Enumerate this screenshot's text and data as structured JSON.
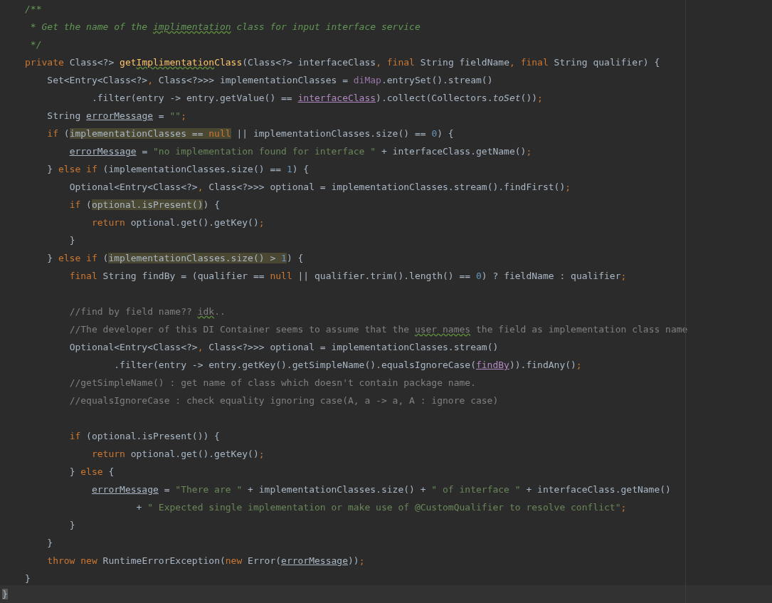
{
  "editor": {
    "lines": [
      {
        "tokens": [
          {
            "text": "/**",
            "kind": "doc"
          }
        ]
      },
      {
        "tokens": [
          {
            "text": " * Get the name of the ",
            "kind": "doc"
          },
          {
            "text": "implimentation",
            "kind": "doc",
            "typo": true
          },
          {
            "text": " class for input interface service",
            "kind": "doc"
          }
        ]
      },
      {
        "tokens": [
          {
            "text": " */",
            "kind": "doc"
          }
        ]
      },
      {
        "tokens": [
          {
            "text": "private ",
            "kind": "keyword"
          },
          {
            "text": "Class<?> ",
            "kind": "plain"
          },
          {
            "text": "get",
            "kind": "method"
          },
          {
            "text": "Implimentation",
            "kind": "method",
            "typo": true
          },
          {
            "text": "Class",
            "kind": "method"
          },
          {
            "text": "(Class<?> interfaceClass",
            "kind": "plain"
          },
          {
            "text": ", final ",
            "kind": "keyword"
          },
          {
            "text": "String fieldName",
            "kind": "plain"
          },
          {
            "text": ", final ",
            "kind": "keyword"
          },
          {
            "text": "String qualifier) {",
            "kind": "plain"
          }
        ]
      },
      {
        "tokens": [
          {
            "text": "    Set<Entry<Class<?>",
            "kind": "plain"
          },
          {
            "text": ", ",
            "kind": "punct"
          },
          {
            "text": "Class<?>>> implementationClasses = ",
            "kind": "plain"
          },
          {
            "text": "diMap",
            "kind": "field"
          },
          {
            "text": ".entrySet().stream()",
            "kind": "plain"
          }
        ]
      },
      {
        "tokens": [
          {
            "text": "            .filter(entry -> entry.getValue() == ",
            "kind": "plain"
          },
          {
            "text": "interfaceClass",
            "kind": "captured"
          },
          {
            "text": ").collect(Collectors.",
            "kind": "plain"
          },
          {
            "text": "toSet",
            "kind": "static"
          },
          {
            "text": "())",
            "kind": "plain"
          },
          {
            "text": ";",
            "kind": "punct"
          }
        ]
      },
      {
        "tokens": [
          {
            "text": "    String ",
            "kind": "plain"
          },
          {
            "text": "errorMessage",
            "kind": "reassigned"
          },
          {
            "text": " = ",
            "kind": "plain"
          },
          {
            "text": "\"\"",
            "kind": "string"
          },
          {
            "text": ";",
            "kind": "punct"
          }
        ]
      },
      {
        "tokens": [
          {
            "text": "    if ",
            "kind": "keyword"
          },
          {
            "text": "(",
            "kind": "plain"
          },
          {
            "text": "implementationClasses == ",
            "kind": "plain",
            "highlighted": true
          },
          {
            "text": "null",
            "kind": "keyword",
            "highlighted": true
          },
          {
            "text": " || implementationClasses.size() == ",
            "kind": "plain"
          },
          {
            "text": "0",
            "kind": "number"
          },
          {
            "text": ") {",
            "kind": "plain"
          }
        ]
      },
      {
        "tokens": [
          {
            "text": "        errorMessage",
            "kind": "reassigned"
          },
          {
            "text": " = ",
            "kind": "plain"
          },
          {
            "text": "\"no implementation found for interface \"",
            "kind": "string"
          },
          {
            "text": " + interfaceClass.getName()",
            "kind": "plain"
          },
          {
            "text": ";",
            "kind": "punct"
          }
        ]
      },
      {
        "tokens": [
          {
            "text": "    } ",
            "kind": "plain"
          },
          {
            "text": "else if ",
            "kind": "keyword"
          },
          {
            "text": "(implementationClasses.size() == ",
            "kind": "plain"
          },
          {
            "text": "1",
            "kind": "number"
          },
          {
            "text": ") {",
            "kind": "plain"
          }
        ]
      },
      {
        "tokens": [
          {
            "text": "        Optional<Entry<Class<?>",
            "kind": "plain"
          },
          {
            "text": ", ",
            "kind": "punct"
          },
          {
            "text": "Class<?>>> optional = implementationClasses.stream().findFirst()",
            "kind": "plain"
          },
          {
            "text": ";",
            "kind": "punct"
          }
        ]
      },
      {
        "tokens": [
          {
            "text": "        if ",
            "kind": "keyword"
          },
          {
            "text": "(",
            "kind": "plain"
          },
          {
            "text": "optional.isPresent()",
            "kind": "plain",
            "highlighted": true
          },
          {
            "text": ") {",
            "kind": "plain"
          }
        ]
      },
      {
        "tokens": [
          {
            "text": "            return ",
            "kind": "keyword"
          },
          {
            "text": "optional.get().getKey()",
            "kind": "plain"
          },
          {
            "text": ";",
            "kind": "punct"
          }
        ]
      },
      {
        "tokens": [
          {
            "text": "        }",
            "kind": "plain"
          }
        ]
      },
      {
        "tokens": [
          {
            "text": "    } ",
            "kind": "plain"
          },
          {
            "text": "else if ",
            "kind": "keyword"
          },
          {
            "text": "(",
            "kind": "plain"
          },
          {
            "text": "implementationClasses.size() > ",
            "kind": "plain",
            "highlighted": true
          },
          {
            "text": "1",
            "kind": "number",
            "highlighted": true
          },
          {
            "text": ") {",
            "kind": "plain"
          }
        ]
      },
      {
        "tokens": [
          {
            "text": "        final ",
            "kind": "keyword"
          },
          {
            "text": "String findBy = (qualifier == ",
            "kind": "plain"
          },
          {
            "text": "null",
            "kind": "keyword"
          },
          {
            "text": " || qualifier.trim().length() == ",
            "kind": "plain"
          },
          {
            "text": "0",
            "kind": "number"
          },
          {
            "text": ") ? fieldName : qualifier",
            "kind": "plain"
          },
          {
            "text": ";",
            "kind": "punct"
          }
        ]
      },
      {
        "blank_line_before": true,
        "tokens": [
          {
            "text": "        //find by field name?? ",
            "kind": "comment"
          },
          {
            "text": "idk",
            "kind": "comment",
            "typo": true
          },
          {
            "text": "..",
            "kind": "comment"
          }
        ]
      },
      {
        "tokens": [
          {
            "text": "        //The developer of this DI Container seems to assume that the ",
            "kind": "comment"
          },
          {
            "text": "user names",
            "kind": "comment",
            "typo": true
          },
          {
            "text": " the field as implementation class name",
            "kind": "comment"
          }
        ]
      },
      {
        "tokens": [
          {
            "text": "        Optional<Entry<Class<?>",
            "kind": "plain"
          },
          {
            "text": ", ",
            "kind": "punct"
          },
          {
            "text": "Class<?>>> optional = implementationClasses.stream()",
            "kind": "plain"
          }
        ]
      },
      {
        "tokens": [
          {
            "text": "                .filter(entry -> entry.getKey().getSimpleName().equalsIgnoreCase(",
            "kind": "plain"
          },
          {
            "text": "findBy",
            "kind": "captured"
          },
          {
            "text": ")).findAny()",
            "kind": "plain"
          },
          {
            "text": ";",
            "kind": "punct"
          }
        ]
      },
      {
        "tokens": [
          {
            "text": "        //getSimpleName() : get name of class which doesn't contain package name.",
            "kind": "comment"
          }
        ]
      },
      {
        "tokens": [
          {
            "text": "        //equalsIgnoreCase : check equality ignoring case(A, a -> a, A : ignore case)",
            "kind": "comment"
          }
        ]
      },
      {
        "blank_line_before": true,
        "tokens": [
          {
            "text": "        if ",
            "kind": "keyword"
          },
          {
            "text": "(optional.isPresent()) {",
            "kind": "plain"
          }
        ]
      },
      {
        "tokens": [
          {
            "text": "            return ",
            "kind": "keyword"
          },
          {
            "text": "optional.get().getKey()",
            "kind": "plain"
          },
          {
            "text": ";",
            "kind": "punct"
          }
        ]
      },
      {
        "tokens": [
          {
            "text": "        } ",
            "kind": "plain"
          },
          {
            "text": "else ",
            "kind": "keyword"
          },
          {
            "text": "{",
            "kind": "plain"
          }
        ]
      },
      {
        "tokens": [
          {
            "text": "            errorMessage",
            "kind": "reassigned"
          },
          {
            "text": " = ",
            "kind": "plain"
          },
          {
            "text": "\"There are \"",
            "kind": "string"
          },
          {
            "text": " + implementationClasses.size() + ",
            "kind": "plain"
          },
          {
            "text": "\" of interface \"",
            "kind": "string"
          },
          {
            "text": " + interfaceClass.getName()",
            "kind": "plain"
          }
        ]
      },
      {
        "tokens": [
          {
            "text": "                    + ",
            "kind": "plain"
          },
          {
            "text": "\" Expected single implementation or make use of @CustomQualifier to resolve conflict\"",
            "kind": "string"
          },
          {
            "text": ";",
            "kind": "punct"
          }
        ]
      },
      {
        "tokens": [
          {
            "text": "        }",
            "kind": "plain"
          }
        ]
      },
      {
        "tokens": [
          {
            "text": "    }",
            "kind": "plain"
          }
        ]
      },
      {
        "tokens": [
          {
            "text": "    throw new ",
            "kind": "keyword"
          },
          {
            "text": "RuntimeErrorException(",
            "kind": "plain"
          },
          {
            "text": "new ",
            "kind": "keyword"
          },
          {
            "text": "Error(",
            "kind": "plain"
          },
          {
            "text": "errorMessage",
            "kind": "reassigned"
          },
          {
            "text": "))",
            "kind": "plain"
          },
          {
            "text": ";",
            "kind": "punct"
          }
        ]
      },
      {
        "tokens": [
          {
            "text": "}",
            "kind": "plain"
          }
        ]
      }
    ],
    "caret_line": {
      "tokens": [
        {
          "text": "}",
          "kind": "plain",
          "highlighted": true
        }
      ]
    }
  }
}
